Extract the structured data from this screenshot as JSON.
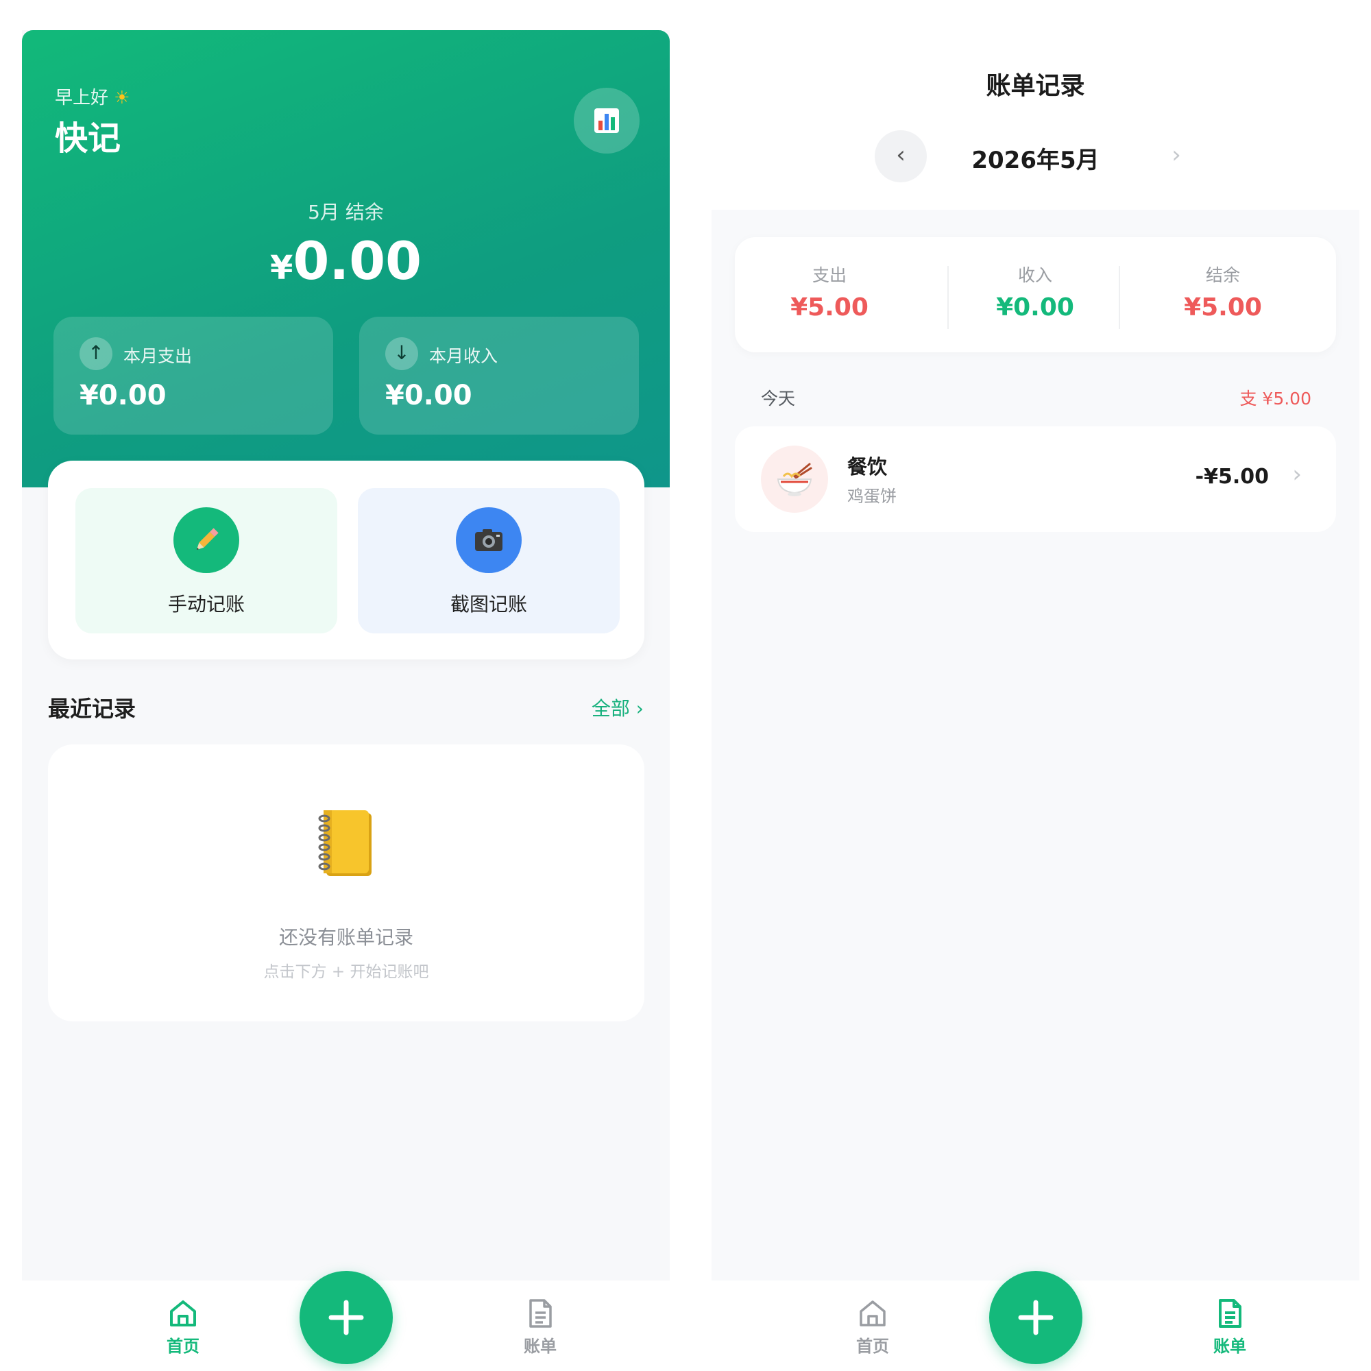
{
  "home": {
    "greeting": "早上好",
    "app_name": "快记",
    "balance_label": "5月 结余",
    "balance_currency": "¥",
    "balance_value": "0.00",
    "expense": {
      "label": "本月支出",
      "value": "¥0.00"
    },
    "income": {
      "label": "本月收入",
      "value": "¥0.00"
    },
    "quick_actions": [
      {
        "label": "手动记账",
        "icon": "pencil-icon"
      },
      {
        "label": "截图记账",
        "icon": "camera-icon"
      }
    ],
    "recent_title": "最近记录",
    "see_all": "全部 ›",
    "empty_title": "还没有账单记录",
    "empty_sub": "点击下方 + 开始记账吧"
  },
  "bills": {
    "title": "账单记录",
    "month": "2026年5月",
    "prev": "‹",
    "next": "›",
    "summary": [
      {
        "label": "支出",
        "value": "¥5.00",
        "color": "#ee5a5a"
      },
      {
        "label": "收入",
        "value": "¥0.00",
        "color": "#14b97b"
      },
      {
        "label": "结余",
        "value": "¥5.00",
        "color": "#ee5a5a"
      }
    ],
    "groups": [
      {
        "day": "今天",
        "total": "支 ¥5.00",
        "items": [
          {
            "category": "餐饮",
            "note": "鸡蛋饼",
            "amount": "-¥5.00",
            "icon": "noodle-bowl-icon"
          }
        ]
      }
    ]
  },
  "tabbar": {
    "home_label": "首页",
    "bill_label": "账单",
    "active_color": "#14b97b",
    "inactive_color": "#9a9da2"
  },
  "colors": {
    "brand_green": "#14b97b",
    "expense_red": "#ee5a5a",
    "camera_blue": "#3d86f2"
  }
}
